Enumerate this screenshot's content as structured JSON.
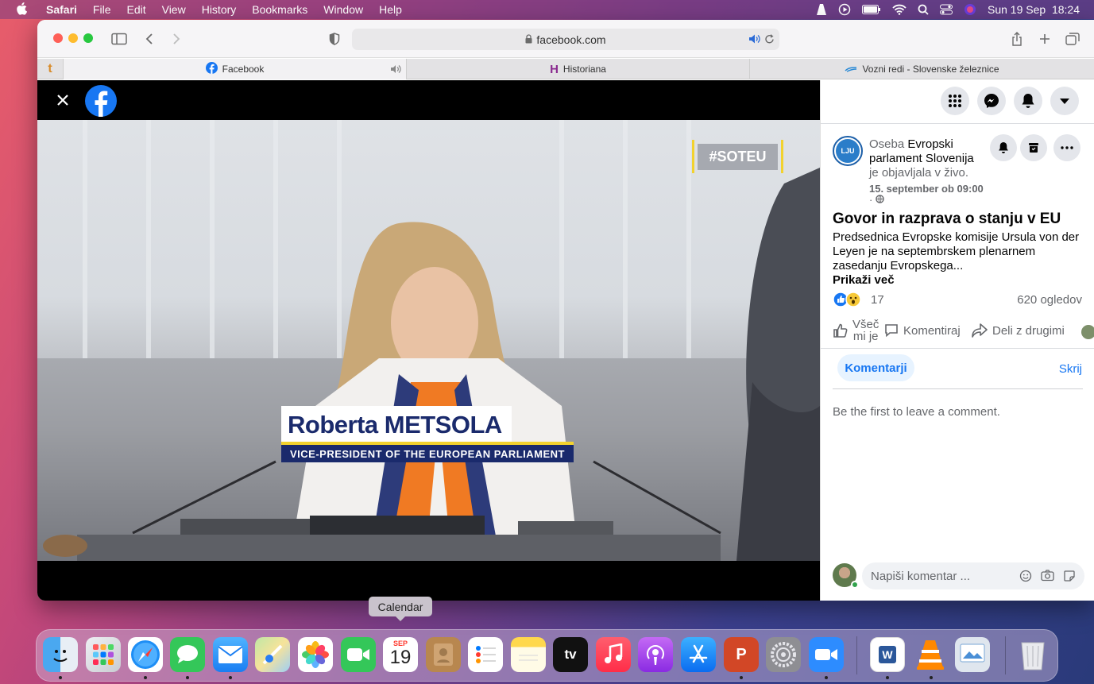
{
  "menubar": {
    "app": "Safari",
    "items": [
      "File",
      "Edit",
      "View",
      "History",
      "Bookmarks",
      "Window",
      "Help"
    ],
    "datetime": "Sun 19 Sep  18:24"
  },
  "browser": {
    "url": "facebook.com",
    "tabs": [
      {
        "label": "Facebook",
        "favicon": "facebook-icon",
        "audio": true
      },
      {
        "label": "Historiana",
        "favicon": "historiana-icon"
      },
      {
        "label": "Vozni redi - Slovenske železnice",
        "favicon": "train-icon"
      }
    ],
    "pinned_tab": "t"
  },
  "video": {
    "hashtag": "#SOTEU",
    "lower_third_name": "Roberta METSOLA",
    "lower_third_title": "VICE-PRESIDENT OF THE EUROPEAN PARLIAMENT"
  },
  "post": {
    "author_prefix": "Oseba ",
    "author": "Evropski parlament Slovenija",
    "action": "je objavljala v živo.",
    "date": "15. september ob 09:00",
    "title": "Govor in razprava o stanju v EU",
    "body": "Predsednica Evropske komisije Ursula von der Leyen je na septembrskem plenarnem zasedanju Evropskega...",
    "more": "Prikaži več",
    "reaction_count": "17",
    "views": "620 ogledov",
    "like_line1": "Všeč",
    "like_line2": "mi je",
    "comment": "Komentiraj",
    "share": "Deli z drugimi",
    "comments_tab": "Komentarji",
    "hide": "Skrij",
    "empty": "Be the first to leave a comment.",
    "input_placeholder": "Napiši komentar ...",
    "avatar_text": "LJU"
  },
  "dock": {
    "tooltip": "Calendar",
    "calendar_month": "SEP",
    "calendar_day": "19",
    "tv_label": "tv"
  },
  "colors": {
    "facebook_blue": "#1877f2",
    "eu_navy": "#1a2a6c",
    "eu_yellow": "#f2d22e"
  }
}
